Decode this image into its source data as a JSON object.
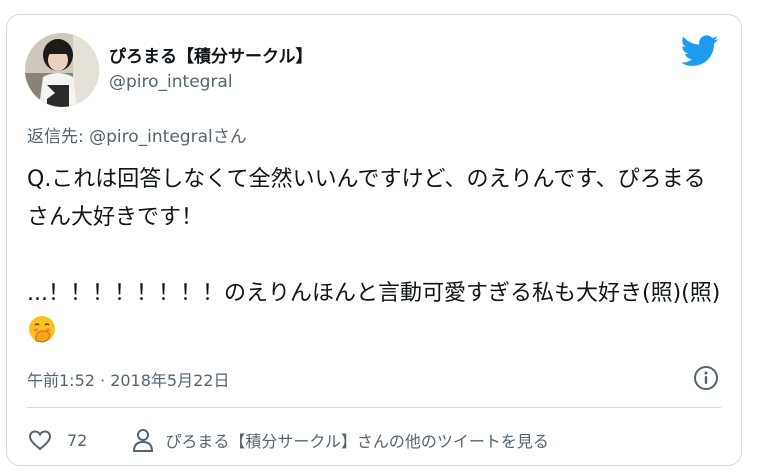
{
  "author": {
    "display_name": "ぴろまる【積分サークル】",
    "handle": "@piro_integral"
  },
  "reply_to": "返信先: @piro_integralさん",
  "tweet": {
    "line1": "Q.これは回答しなくて全然いいんですけど、のえりんです、ぴろまるさん大好きです！",
    "line2": "...！！！！！！！！のえりんほんと言動可愛すぎる私も大好き(照)(照)"
  },
  "timestamp": "午前1:52 · 2018年5月22日",
  "footer": {
    "like_count": "72",
    "more_tweets_label": "ぴろまる【積分サークル】さんの他のツイートを見る"
  },
  "icons": {
    "logo": "twitter-bird-icon",
    "info": "info-icon",
    "like": "heart-icon",
    "profile": "person-icon",
    "emoji": "face-with-hand-over-mouth-emoji"
  },
  "colors": {
    "brand": "#1d9bf0",
    "text": "#0f1419",
    "secondary": "#536471",
    "border": "#cfd9de"
  }
}
